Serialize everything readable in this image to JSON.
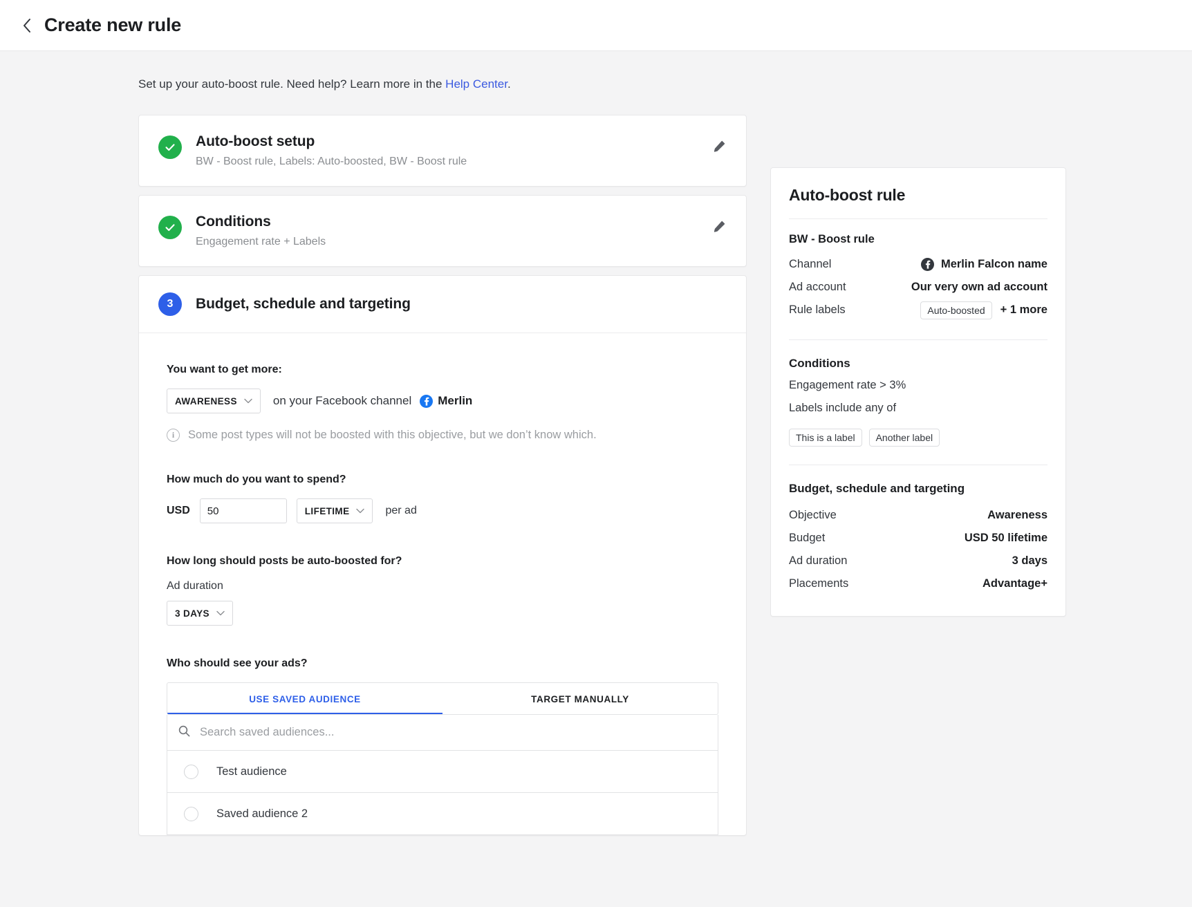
{
  "header": {
    "back_icon": "chevron-left-icon",
    "title": "Create new rule"
  },
  "intro": {
    "text_before": "Set up your auto-boost rule. Need help? Learn more in the ",
    "link": "Help Center",
    "text_after": "."
  },
  "steps": [
    {
      "status": "done",
      "icon": "check-icon",
      "title": "Auto-boost setup",
      "subtitle": "BW - Boost rule, Labels: Auto-boosted, BW - Boost rule",
      "edit_icon": "pencil-icon"
    },
    {
      "status": "done",
      "icon": "check-icon",
      "title": "Conditions",
      "subtitle": "Engagement rate + Labels",
      "edit_icon": "pencil-icon"
    },
    {
      "status": "active",
      "number": "3",
      "title": "Budget, schedule and targeting"
    }
  ],
  "form": {
    "objective_label": "You want to get more:",
    "objective_value": "AWARENESS",
    "objective_suffix": "on your Facebook channel",
    "channel_name": "Merlin",
    "channel_icon": "facebook-icon",
    "note_icon": "info-icon",
    "note": "Some post types will not be boosted with this objective, but we don’t know which.",
    "spend_label": "How much do you want to spend?",
    "currency": "USD",
    "amount_value": "50",
    "amount_placeholder": "",
    "budget_type": "LIFETIME",
    "per_ad": "per ad",
    "duration_label": "How long should posts be auto-boosted for?",
    "duration_sub_label": "Ad duration",
    "duration_value": "3 DAYS",
    "audience_label": "Who should see your ads?",
    "tabs": [
      {
        "label": "USE SAVED AUDIENCE",
        "active": true
      },
      {
        "label": "TARGET MANUALLY",
        "active": false
      }
    ],
    "search_placeholder": "Search saved audiences...",
    "search_icon": "search-icon",
    "audiences": [
      {
        "label": "Test audience",
        "selected": false
      },
      {
        "label": "Saved audience 2",
        "selected": false
      }
    ]
  },
  "summary": {
    "title": "Auto-boost rule",
    "rule_name": "BW - Boost rule",
    "channel_key": "Channel",
    "channel_value": "Merlin Falcon name",
    "channel_icon": "facebook-icon",
    "ad_account_key": "Ad account",
    "ad_account_value": "Our very own ad account",
    "rule_labels_key": "Rule labels",
    "rule_label_chip": "Auto-boosted",
    "rule_labels_more": "+ 1 more",
    "conditions_head": "Conditions",
    "condition_1": "Engagement rate > 3%",
    "condition_2": "Labels include any of",
    "condition_chips": [
      "This is a label",
      "Another label"
    ],
    "budget_head": "Budget, schedule and targeting",
    "rows": [
      {
        "key": "Objective",
        "value": "Awareness"
      },
      {
        "key": "Budget",
        "value": "USD 50 lifetime"
      },
      {
        "key": "Ad duration",
        "value": "3 days"
      },
      {
        "key": "Placements",
        "value": "Advantage+"
      }
    ]
  },
  "colors": {
    "accent": "#2e5fe8",
    "success": "#21b04b",
    "link": "#3b5ae0",
    "facebook": "#1877f2"
  }
}
